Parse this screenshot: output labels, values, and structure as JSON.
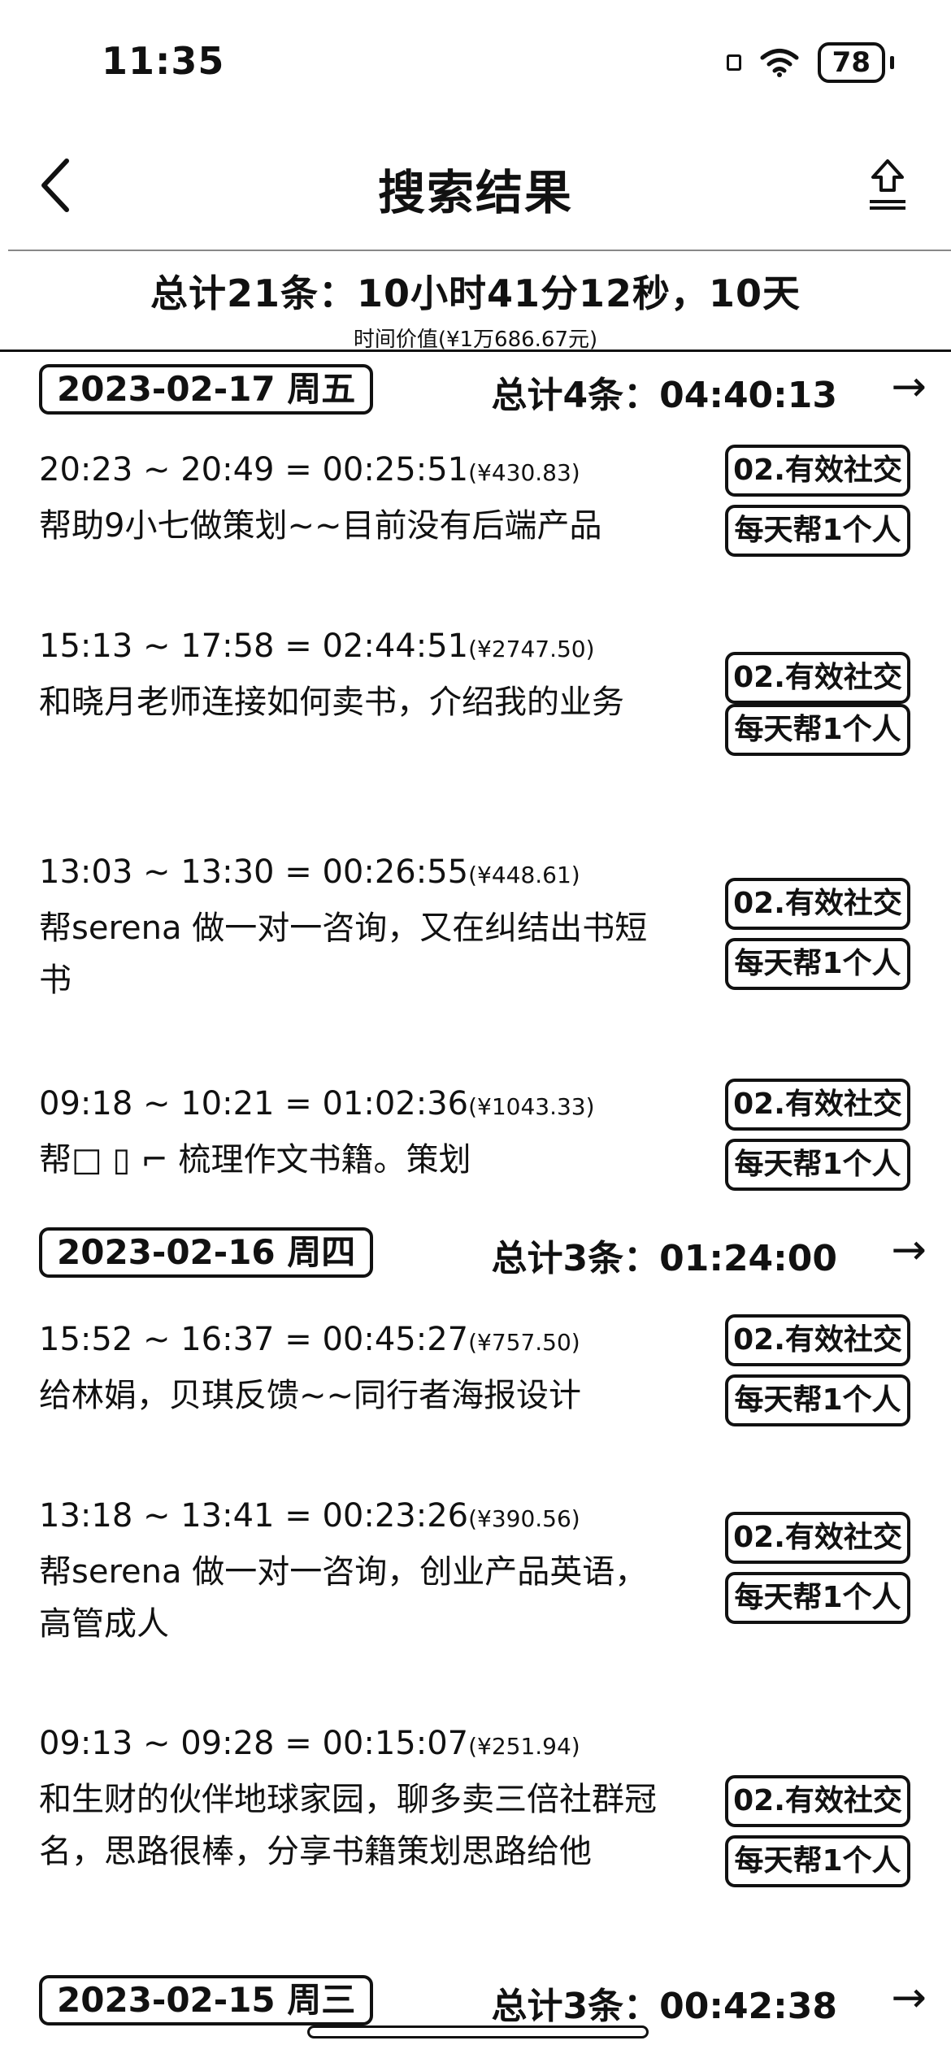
{
  "status": {
    "time": "11:35",
    "battery": "78"
  },
  "nav": {
    "title": "搜索结果"
  },
  "summary": {
    "main": "总计21条：10小时41分12秒，10天",
    "sub": "时间价值(¥1万686.67元)"
  },
  "groups": [
    {
      "date": "2023-02-17 周五",
      "total": "总计4条：04:40:13",
      "entries": [
        {
          "time": "20:23 ~ 20:49 = 00:25:51",
          "cost": "(¥430.83)",
          "desc": "帮助9小七做策划~~目前没有后端产品",
          "tag1": "02.有效社交",
          "tag2": "每天帮1个人"
        },
        {
          "time": "15:13 ~ 17:58 = 02:44:51",
          "cost": "(¥2747.50)",
          "desc": "和晓月老师连接如何卖书，介绍我的业务",
          "tag1": "02.有效社交",
          "tag2": "每天帮1个人"
        },
        {
          "time": "13:03 ~ 13:30 = 00:26:55",
          "cost": "(¥448.61)",
          "desc": "帮serena 做一对一咨询，又在纠结出书短书",
          "tag1": "02.有效社交",
          "tag2": "每天帮1个人"
        },
        {
          "time": "09:18 ~ 10:21 = 01:02:36",
          "cost": "(¥1043.33)",
          "desc": "帮□ ▯ ⌐ 梳理作文书籍。策划",
          "tag1": "02.有效社交",
          "tag2": "每天帮1个人"
        }
      ]
    },
    {
      "date": "2023-02-16 周四",
      "total": "总计3条：01:24:00",
      "entries": [
        {
          "time": "15:52 ~ 16:37 = 00:45:27",
          "cost": "(¥757.50)",
          "desc": "给林娟，贝琪反馈~~同行者海报设计",
          "tag1": "02.有效社交",
          "tag2": "每天帮1个人"
        },
        {
          "time": "13:18 ~ 13:41 = 00:23:26",
          "cost": "(¥390.56)",
          "desc": "帮serena 做一对一咨询，创业产品英语，高管成人",
          "tag1": "02.有效社交",
          "tag2": "每天帮1个人"
        },
        {
          "time": "09:13 ~ 09:28 = 00:15:07",
          "cost": "(¥251.94)",
          "desc": "和生财的伙伴地球家园，聊多卖三倍社群冠名，思路很棒，分享书籍策划思路给他",
          "tag1": "02.有效社交",
          "tag2": "每天帮1个人"
        }
      ]
    },
    {
      "date": "2023-02-15 周三",
      "total": "总计3条：00:42:38",
      "entries": []
    }
  ]
}
